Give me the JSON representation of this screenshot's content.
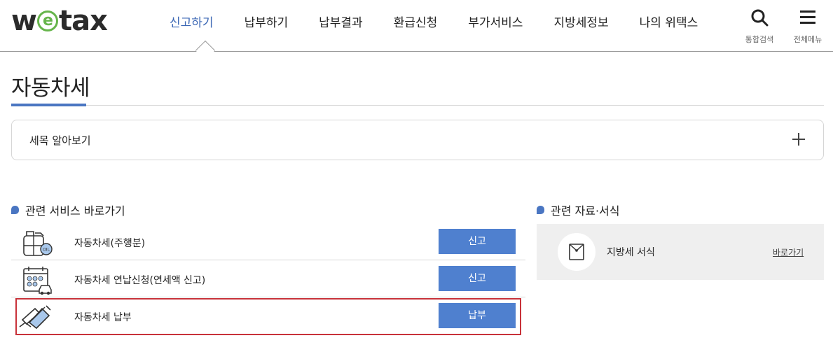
{
  "header": {
    "logo": {
      "prefix": "w",
      "accent": "e",
      "suffix": "tax"
    },
    "nav": [
      "신고하기",
      "납부하기",
      "납부결과",
      "환급신청",
      "부가서비스",
      "지방세정보",
      "나의 위택스"
    ],
    "active_nav_index": 0,
    "tools": {
      "search_label": "통합검색",
      "menu_label": "전체메뉴"
    }
  },
  "page": {
    "title": "자동차세"
  },
  "accordion": {
    "label": "세목 알아보기"
  },
  "services": {
    "heading": "관련 서비스 바로가기",
    "items": [
      {
        "label": "자동차세(주행분)",
        "button": "신고",
        "icon": "oil-tank-icon"
      },
      {
        "label": "자동차세 연납신청(연세액 신고)",
        "button": "신고",
        "icon": "calendar-car-icon"
      },
      {
        "label": "자동차세 납부",
        "button": "납부",
        "icon": "card-payment-icon"
      }
    ],
    "highlighted_index": 2
  },
  "resources": {
    "heading": "관련 자료·서식",
    "item_label": "지방세 서식",
    "link_label": "바로가기",
    "icon": "envelope-icon"
  },
  "colors": {
    "accent": "#4a76c2",
    "button": "#4f80cf",
    "highlight": "#c8323a",
    "logo_e": "#66b54b"
  }
}
